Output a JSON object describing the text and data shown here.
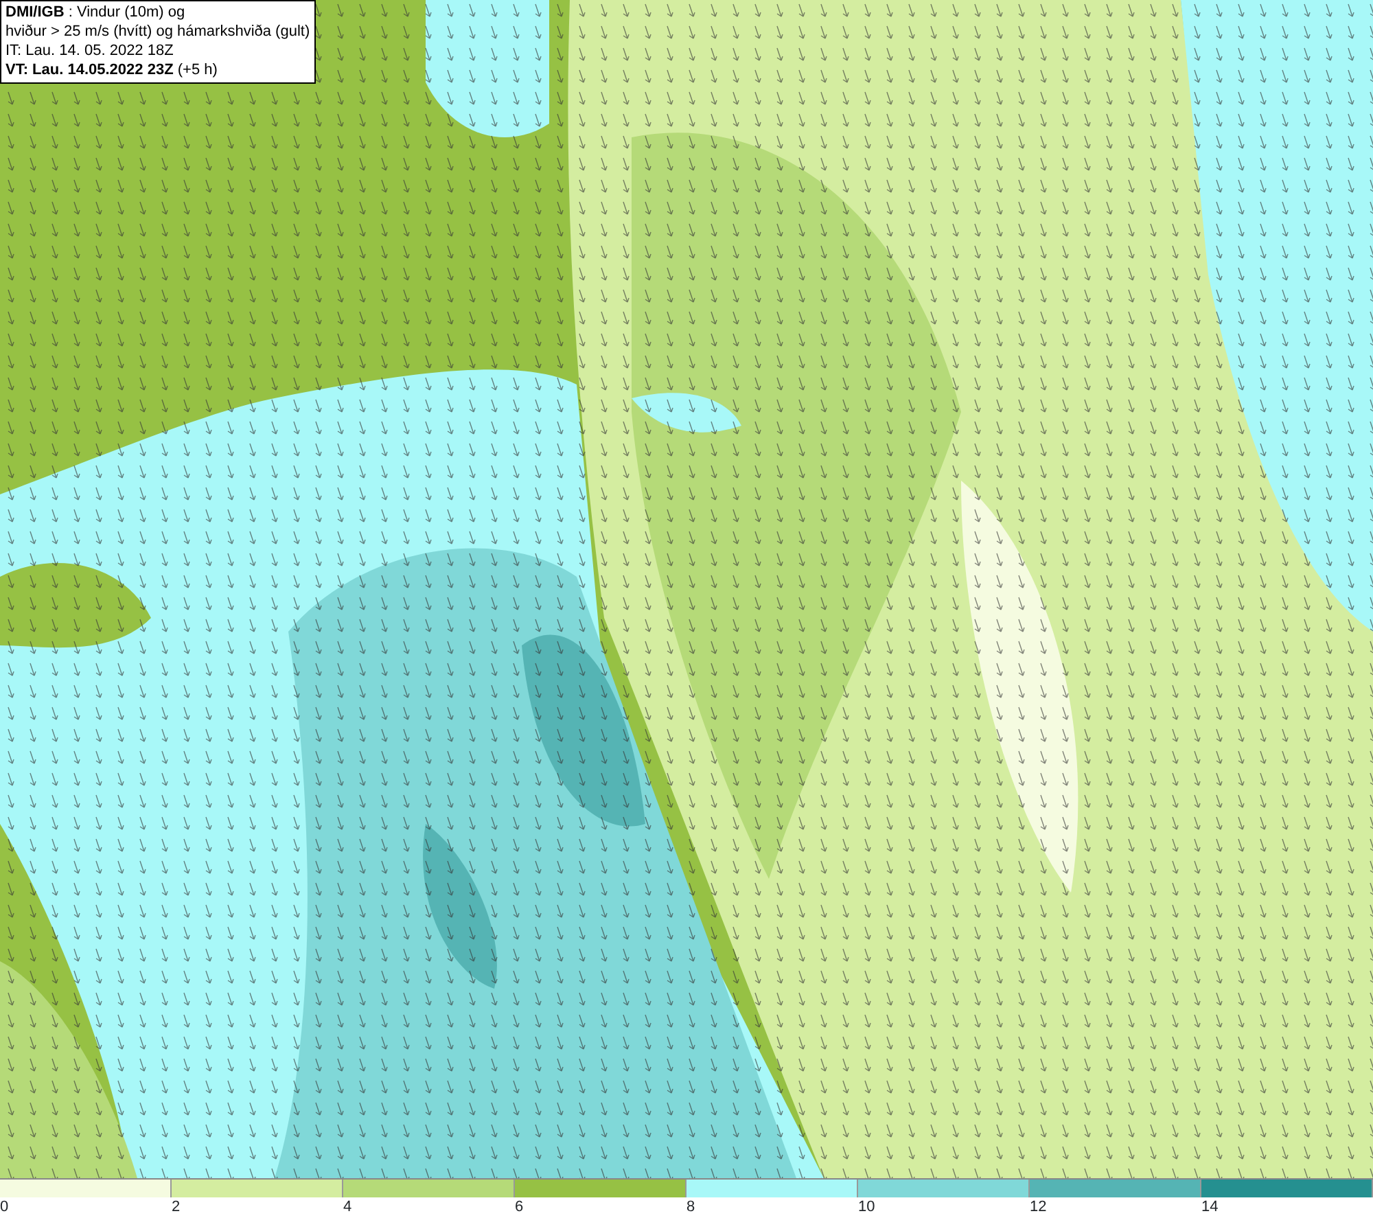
{
  "legend": {
    "lines": [
      "**DMI/IGB** : Vindur (10m) og",
      "hviður > 25 m/s (hvítt) og hámarkshviða (gult)",
      "IT: Lau. 14. 05. 2022 18Z",
      "**VT: Lau. 14.05.2022 23Z** (+5 h)"
    ]
  },
  "color_bar": {
    "segments": [
      {
        "color": "#f5fbe0",
        "label": "0"
      },
      {
        "color": "#d4eda0",
        "label": "2"
      },
      {
        "color": "#b5da78",
        "label": "4"
      },
      {
        "color": "#96c144",
        "label": "6"
      },
      {
        "color": "#a8f8f8",
        "label": "8"
      },
      {
        "color": "#80d8d8",
        "label": "10"
      },
      {
        "color": "#55b4b4",
        "label": "12"
      },
      {
        "color": "#259090",
        "label": "14"
      }
    ]
  }
}
